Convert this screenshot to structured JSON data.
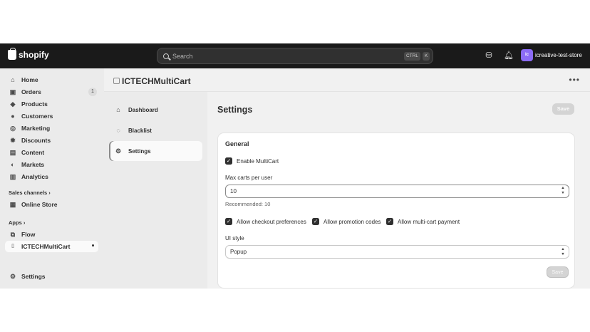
{
  "topbar": {
    "logo_text": "shopify",
    "search_placeholder": "Search",
    "shortcut_ctrl": "CTRL",
    "shortcut_k": "K",
    "avatar_initials": "ic",
    "store_name": "icreative-test-store"
  },
  "sidebar": {
    "items": [
      {
        "label": "Home",
        "icon": "home-icon"
      },
      {
        "label": "Orders",
        "icon": "inbox-icon",
        "badge": "1"
      },
      {
        "label": "Products",
        "icon": "tag-icon"
      },
      {
        "label": "Customers",
        "icon": "person-icon"
      },
      {
        "label": "Marketing",
        "icon": "target-icon"
      },
      {
        "label": "Discounts",
        "icon": "discount-icon"
      },
      {
        "label": "Content",
        "icon": "content-icon"
      },
      {
        "label": "Markets",
        "icon": "globe-icon"
      },
      {
        "label": "Analytics",
        "icon": "chart-icon"
      }
    ],
    "sales_channels_label": "Sales channels",
    "online_store_label": "Online Store",
    "apps_label": "Apps",
    "flow_label": "Flow",
    "app_active_label": "ICTECHMultiCart",
    "settings_label": "Settings"
  },
  "app": {
    "title": "ICTECHMultiCart",
    "subnav": [
      {
        "label": "Dashboard",
        "icon": "home-icon"
      },
      {
        "label": "Blacklist",
        "icon": "blacklist-icon"
      },
      {
        "label": "Settings",
        "icon": "gear-icon"
      }
    ]
  },
  "settings": {
    "page_title": "Settings",
    "save_label": "Save",
    "card_title": "General",
    "enable_multicart": "Enable MultiCart",
    "max_carts_label": "Max carts per user",
    "max_carts_value": "10",
    "recommended_text": "Recommended: 10",
    "allow_checkout": "Allow checkout preferences",
    "allow_promo": "Allow promotion codes",
    "allow_multi_payment": "Allow multi-cart payment",
    "ui_style_label": "UI style",
    "ui_style_value": "Popup",
    "bottom_save_label": "Save"
  }
}
